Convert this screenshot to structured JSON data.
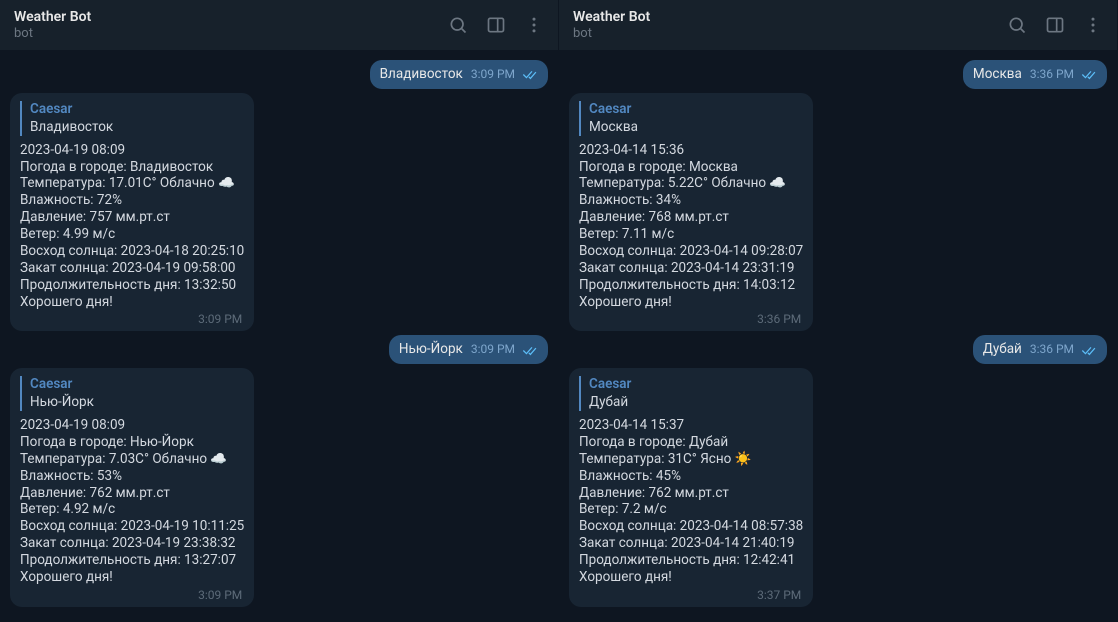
{
  "panes": [
    {
      "header": {
        "title": "Weather Bot",
        "subtitle": "bot"
      },
      "messages": [
        {
          "dir": "out",
          "text": "Владивосток",
          "time": "3:09 PM"
        },
        {
          "dir": "in",
          "reply": {
            "name": "Caesar",
            "text": "Владивосток"
          },
          "lines": [
            "2023-04-19 08:09",
            "Погода в городе: Владивосток",
            "Температура: 17.01C° Облачно ☁️",
            "Влажность: 72%",
            "Давление: 757 мм.рт.ст",
            "Ветер: 4.99 м/с",
            "Восход солнца: 2023-04-18 20:25:10",
            "Закат солнца: 2023-04-19 09:58:00",
            "Продолжительность дня: 13:32:50",
            "Хорошего дня!"
          ],
          "time": "3:09 PM"
        },
        {
          "dir": "out",
          "text": "Нью-Йорк",
          "time": "3:09 PM"
        },
        {
          "dir": "in",
          "reply": {
            "name": "Caesar",
            "text": "Нью-Йорк"
          },
          "lines": [
            "2023-04-19 08:09",
            "Погода в городе: Нью-Йорк",
            "Температура: 7.03C° Облачно ☁️",
            "Влажность: 53%",
            "Давление: 762 мм.рт.ст",
            "Ветер: 4.92 м/с",
            "Восход солнца: 2023-04-19 10:11:25",
            "Закат солнца: 2023-04-19 23:38:32",
            "Продолжительность дня: 13:27:07",
            "Хорошего дня!"
          ],
          "time": "3:09 PM"
        }
      ]
    },
    {
      "header": {
        "title": "Weather Bot",
        "subtitle": "bot"
      },
      "messages": [
        {
          "dir": "out",
          "text": "Москва",
          "time": "3:36 PM"
        },
        {
          "dir": "in",
          "reply": {
            "name": "Caesar",
            "text": "Москва"
          },
          "lines": [
            "2023-04-14 15:36",
            "Погода в городе: Москва",
            "Температура: 5.22C° Облачно ☁️",
            "Влажность: 34%",
            "Давление: 768 мм.рт.ст",
            "Ветер: 7.11 м/с",
            "Восход солнца: 2023-04-14 09:28:07",
            "Закат солнца: 2023-04-14 23:31:19",
            "Продолжительность дня: 14:03:12",
            "Хорошего дня!"
          ],
          "time": "3:36 PM"
        },
        {
          "dir": "out",
          "text": "Дубай",
          "time": "3:36 PM"
        },
        {
          "dir": "in",
          "reply": {
            "name": "Caesar",
            "text": "Дубай"
          },
          "lines": [
            "2023-04-14 15:37",
            "Погода в городе: Дубай",
            "Температура: 31C° Ясно ☀️",
            "Влажность: 45%",
            "Давление: 762 мм.рт.ст",
            "Ветер: 7.2 м/с",
            "Восход солнца: 2023-04-14 08:57:38",
            "Закат солнца: 2023-04-14 21:40:19",
            "Продолжительность дня: 12:42:41",
            "Хорошего дня!"
          ],
          "time": "3:37 PM"
        }
      ]
    }
  ]
}
